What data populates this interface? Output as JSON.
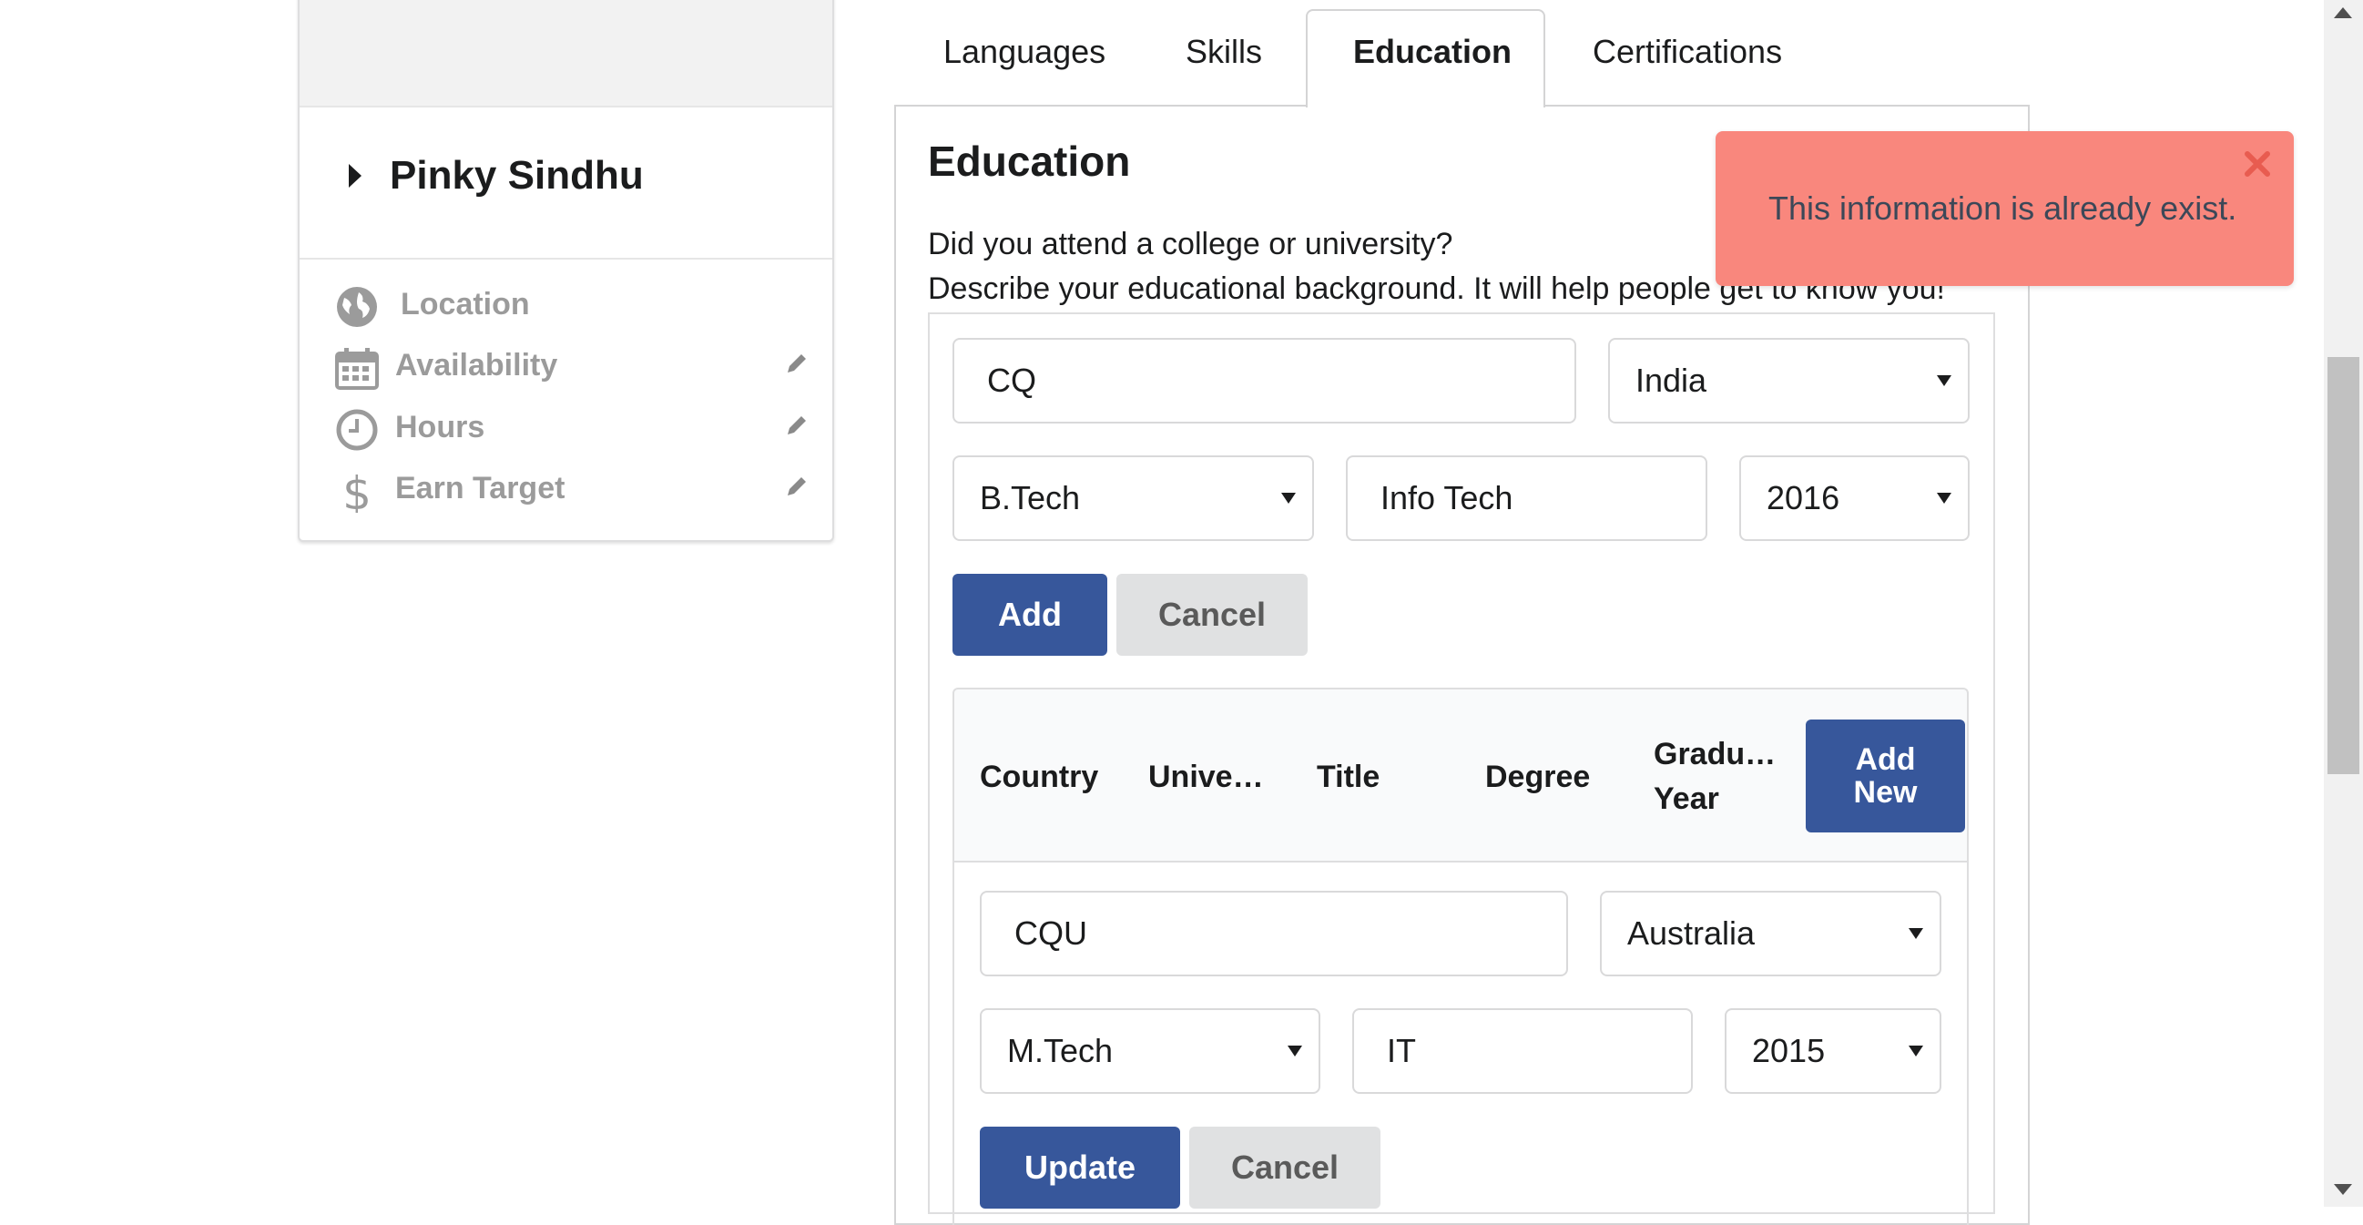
{
  "profile": {
    "name": "Pinky Sindhu",
    "meta": [
      {
        "icon": "globe-icon",
        "label": "Location",
        "editable": false
      },
      {
        "icon": "calendar-icon",
        "label": "Availability",
        "editable": true
      },
      {
        "icon": "clock-icon",
        "label": "Hours",
        "editable": true
      },
      {
        "icon": "dollar-icon",
        "label": "Earn Target",
        "editable": true
      }
    ]
  },
  "tabs": [
    "Languages",
    "Skills",
    "Education",
    "Certifications"
  ],
  "active_tab": "Education",
  "education": {
    "title": "Education",
    "desc_line1": "Did you attend a college or university?",
    "desc_line2": "Describe your educational background. It will help people get to know you!",
    "new_form": {
      "university": "CQ",
      "country": "India",
      "title": "B.Tech",
      "degree": "Info Tech",
      "year": "2016",
      "add_label": "Add",
      "cancel_label": "Cancel"
    },
    "table": {
      "headers": [
        "Country",
        "Unive…",
        "Title",
        "Degree",
        "Gradu…",
        "Year"
      ],
      "add_new_line1": "Add",
      "add_new_line2": "New"
    },
    "edit_form": {
      "university": "CQU",
      "country": "Australia",
      "title": "M.Tech",
      "degree": "IT",
      "year": "2015",
      "update_label": "Update",
      "cancel_label": "Cancel"
    }
  },
  "toast": {
    "message": "This information is already exist.",
    "color": "#f9877d"
  },
  "colors": {
    "primary": "#37579b",
    "secondary": "#e0e1e2"
  }
}
